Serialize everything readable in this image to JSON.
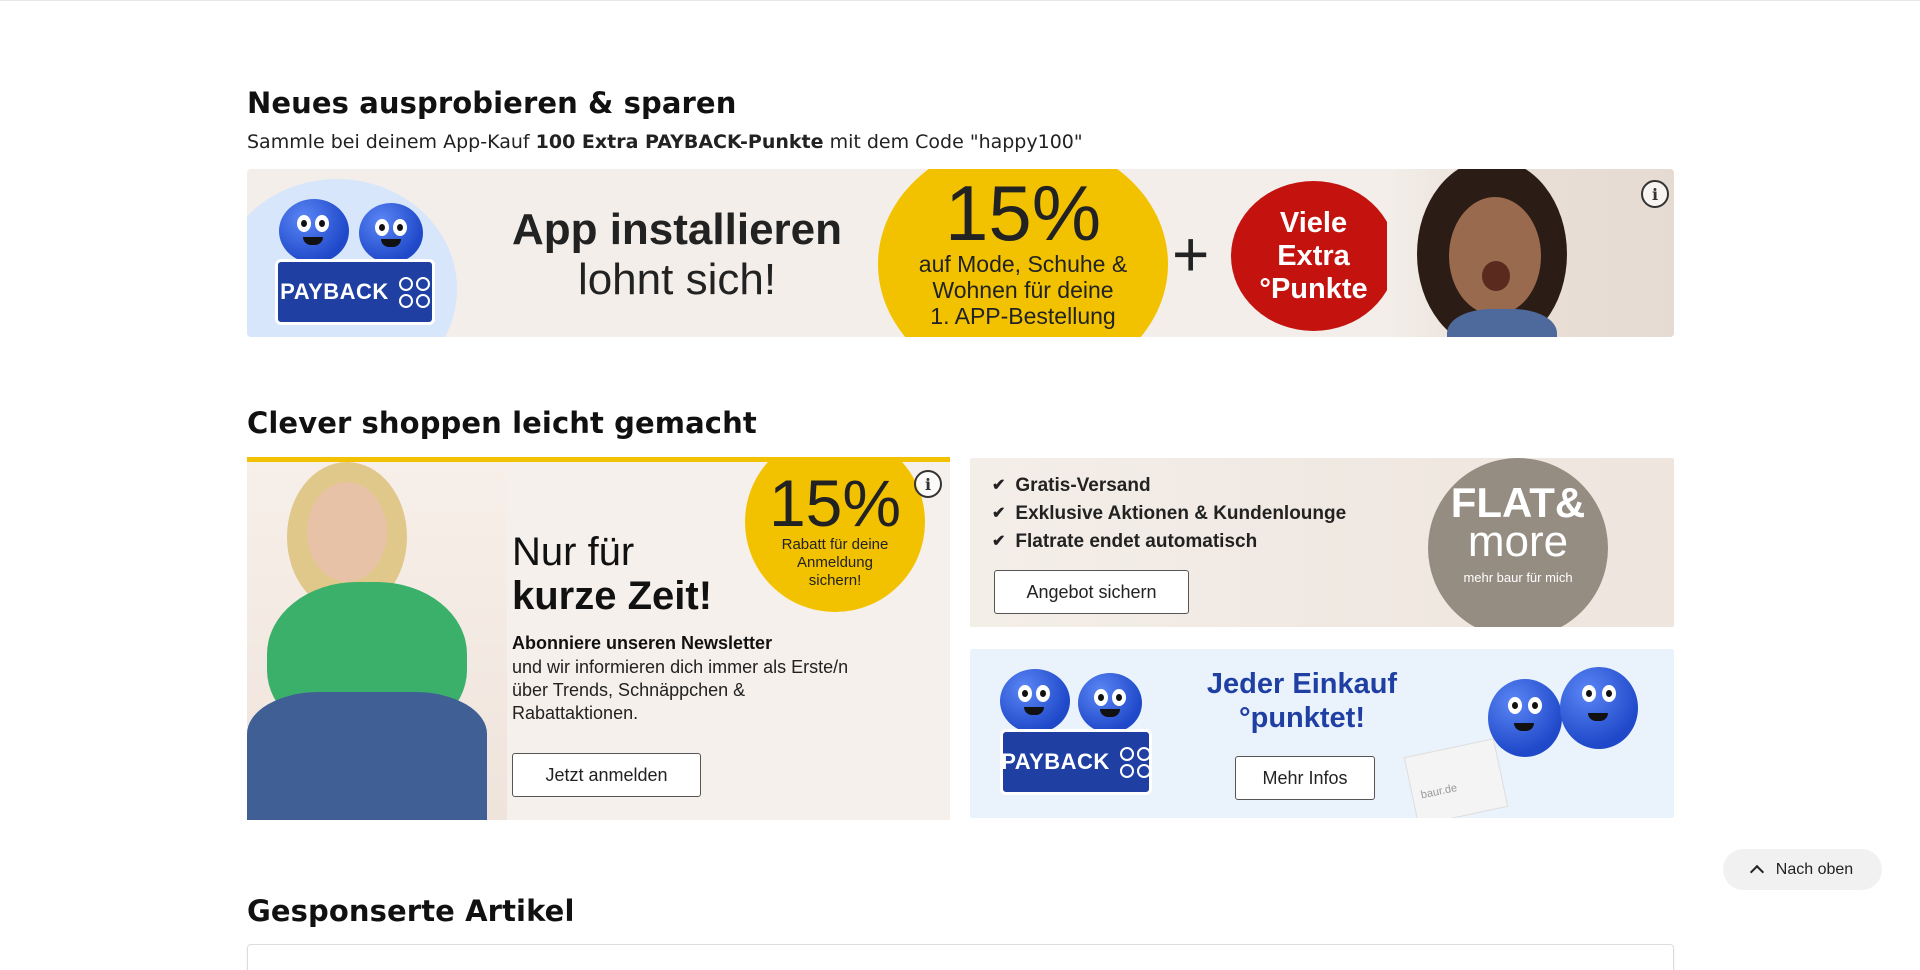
{
  "section1": {
    "title": "Neues ausprobieren & sparen",
    "sub_prefix": "Sammle bei deinem App-Kauf ",
    "sub_bold": "100 Extra PAYBACK-Punkte",
    "sub_suffix": " mit dem Code \"happy100\""
  },
  "app_banner": {
    "line1": "App installieren",
    "line2": "lohnt sich!",
    "percent": "15%",
    "offer_lines": [
      "auf Mode, Schuhe &",
      "Wohnen für deine",
      "1. APP-Bestellung"
    ],
    "plus": "+",
    "badge_lines": [
      "Viele",
      "Extra",
      "°Punkte"
    ],
    "logo_text": "PAYBACK"
  },
  "section2": {
    "title": "Clever shoppen leicht gemacht"
  },
  "newsletter_banner": {
    "percent": "15%",
    "percent_text": [
      "Rabatt für deine",
      "Anmeldung",
      "sichern!"
    ],
    "headline_line1": "Nur für",
    "headline_line2": "kurze Zeit!",
    "sub_bold": "Abonniere unseren Newsletter",
    "sub_text": "und wir informieren dich immer als Erste/n über Trends, Schnäppchen & Rabattaktionen.",
    "button": "Jetzt anmelden"
  },
  "flat_banner": {
    "items": [
      "Gratis-Versand",
      "Exklusive Aktionen & Kundenlounge",
      "Flatrate endet automatisch"
    ],
    "button": "Angebot sichern",
    "logo_line1": "FLAT&",
    "logo_line2": "more",
    "logo_line3": "mehr baur für mich"
  },
  "payback_banner": {
    "headline_line1": "Jeder Einkauf",
    "headline_line2": "°punktet!",
    "button": "Mehr Infos",
    "logo_text": "PAYBACK",
    "box_text": "baur.de"
  },
  "back_to_top": "Nach oben",
  "section3": {
    "title": "Gesponserte Artikel"
  },
  "colors": {
    "accent_yellow": "#f2c200",
    "payback_blue": "#1f3fa3",
    "badge_red": "#c4120f"
  }
}
